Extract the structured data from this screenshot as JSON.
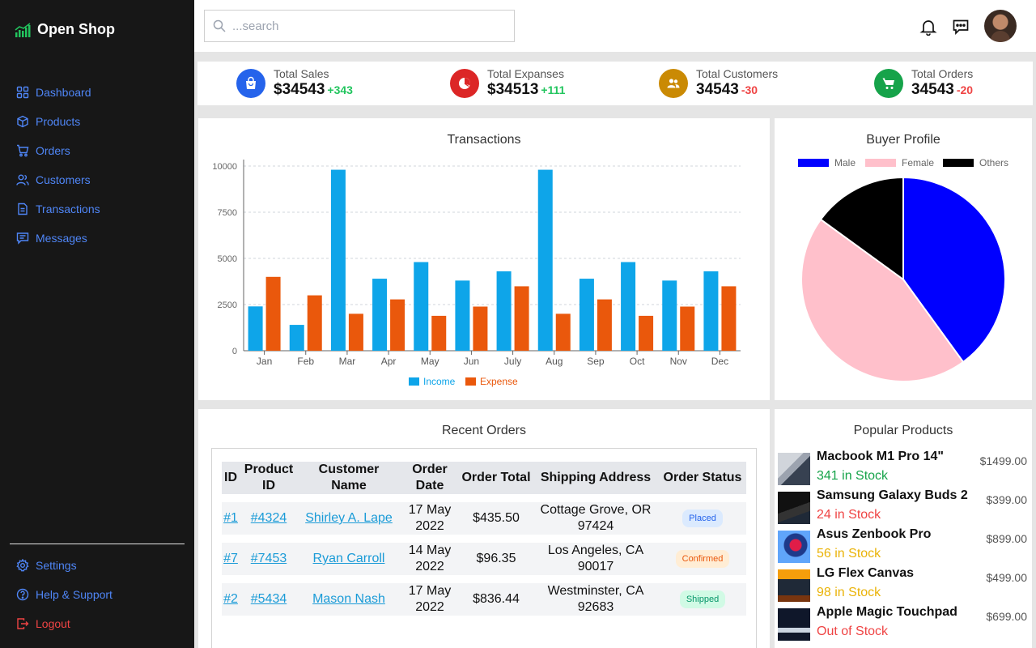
{
  "brand": {
    "name": "Open Shop"
  },
  "sidebar": {
    "items": [
      {
        "label": "Dashboard",
        "icon": "grid-icon"
      },
      {
        "label": "Products",
        "icon": "box-icon"
      },
      {
        "label": "Orders",
        "icon": "cart-icon"
      },
      {
        "label": "Customers",
        "icon": "users-icon"
      },
      {
        "label": "Transactions",
        "icon": "document-icon"
      },
      {
        "label": "Messages",
        "icon": "message-icon"
      }
    ],
    "bottom_items": [
      {
        "label": "Settings",
        "icon": "gear-icon"
      },
      {
        "label": "Help & Support",
        "icon": "help-icon"
      },
      {
        "label": "Logout",
        "icon": "logout-icon"
      }
    ],
    "accent": "#4f86f7",
    "logout_color": "#ef4444"
  },
  "header": {
    "search_placeholder": "...search"
  },
  "stats": [
    {
      "label": "Total Sales",
      "value": "$34543",
      "delta": "+343",
      "color": "#2563eb",
      "icon": "shopping-bag-icon"
    },
    {
      "label": "Total Expanses",
      "value": "$34513",
      "delta": "+111",
      "color": "#dc2626",
      "icon": "pie-chart-icon"
    },
    {
      "label": "Total Customers",
      "value": "34543",
      "delta": "-30",
      "color": "#ca8a04",
      "icon": "users-icon"
    },
    {
      "label": "Total Orders",
      "value": "34543",
      "delta": "-20",
      "color": "#16a34a",
      "icon": "cart-icon"
    }
  ],
  "chart_data": [
    {
      "type": "bar",
      "title": "Transactions",
      "categories": [
        "Jan",
        "Feb",
        "Mar",
        "Apr",
        "May",
        "Jun",
        "July",
        "Aug",
        "Sep",
        "Oct",
        "Nov",
        "Dec"
      ],
      "series": [
        {
          "name": "Income",
          "color": "#0ea5e9",
          "values": [
            2400,
            1400,
            9800,
            3900,
            4800,
            3800,
            4300,
            9800,
            3900,
            4800,
            3800,
            4300
          ]
        },
        {
          "name": "Expense",
          "color": "#ea580c",
          "values": [
            4000,
            3000,
            2000,
            2780,
            1890,
            2390,
            3490,
            2000,
            2780,
            1890,
            2390,
            3490
          ]
        }
      ],
      "yticks": [
        "0",
        "2500",
        "5000",
        "7500",
        "10000"
      ],
      "ylim": [
        0,
        10000
      ],
      "grid": true,
      "legend": "bottom"
    },
    {
      "type": "pie",
      "title": "Buyer Profile",
      "labels": [
        "Male",
        "Female",
        "Others"
      ],
      "values": [
        40,
        45,
        15
      ],
      "colors": [
        "#0000ff",
        "#ffc0cb",
        "#000000"
      ],
      "legend": "top"
    }
  ],
  "orders": {
    "title": "Recent Orders",
    "headers": [
      "ID",
      "Product ID",
      "Customer Name",
      "Order Date",
      "Order Total",
      "Shipping Address",
      "Order Status"
    ],
    "rows": [
      {
        "id": "#1",
        "product_id": "#4324",
        "customer": "Shirley A. Lape",
        "date": "17 May 2022",
        "total": "$435.50",
        "address": "Cottage Grove, OR 97424",
        "status": "Placed"
      },
      {
        "id": "#7",
        "product_id": "#7453",
        "customer": "Ryan Carroll",
        "date": "14 May 2022",
        "total": "$96.35",
        "address": "Los Angeles, CA 90017",
        "status": "Confirmed"
      },
      {
        "id": "#2",
        "product_id": "#5434",
        "customer": "Mason Nash",
        "date": "17 May 2022",
        "total": "$836.44",
        "address": "Westminster, CA 92683",
        "status": "Shipped"
      }
    ],
    "status_colors": {
      "Placed": {
        "bg": "#dbeafe",
        "fg": "#2563eb"
      },
      "Confirmed": {
        "bg": "#ffedd5",
        "fg": "#ea580c"
      },
      "Shipped": {
        "bg": "#d1fae5",
        "fg": "#059669"
      }
    }
  },
  "popular": {
    "title": "Popular Products",
    "items": [
      {
        "name": "Macbook M1 Pro 14\"",
        "stock": "341 in Stock",
        "price": "$1499.00",
        "stock_color": "#16a34a"
      },
      {
        "name": "Samsung Galaxy Buds 2",
        "stock": "24 in Stock",
        "price": "$399.00",
        "stock_color": "#ef4444"
      },
      {
        "name": "Asus Zenbook Pro",
        "stock": "56 in Stock",
        "price": "$899.00",
        "stock_color": "#eab308"
      },
      {
        "name": "LG Flex Canvas",
        "stock": "98 in Stock",
        "price": "$499.00",
        "stock_color": "#eab308"
      },
      {
        "name": "Apple Magic Touchpad",
        "stock": "Out of Stock",
        "price": "$699.00",
        "stock_color": "#ef4444"
      }
    ]
  }
}
